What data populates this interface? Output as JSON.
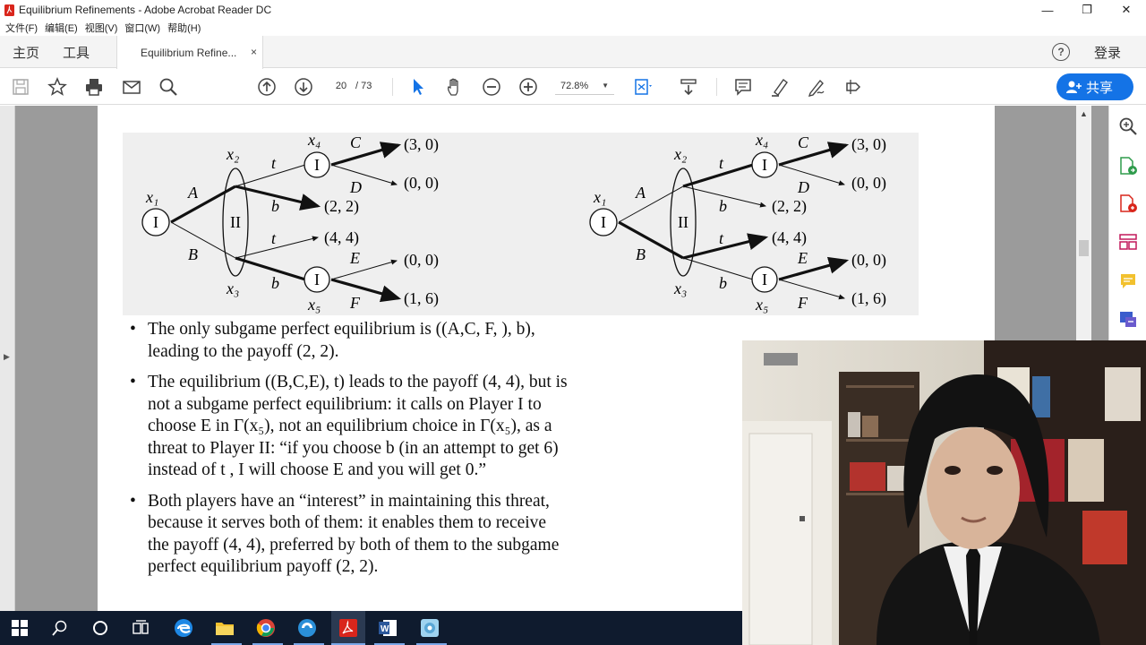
{
  "window": {
    "title": "Equilibrium Refinements - Adobe Acrobat Reader DC",
    "controls": [
      "—",
      "❐",
      "✕"
    ]
  },
  "menu": [
    "文件(F)",
    "编辑(E)",
    "视图(V)",
    "窗口(W)",
    "帮助(H)"
  ],
  "tabs": {
    "home": "主页",
    "tools": "工具",
    "document": "Equilibrium Refine...",
    "close": "×",
    "help": "?",
    "login": "登录"
  },
  "toolbar": {
    "page_current": "20",
    "page_total": "/ 73",
    "zoom": "72.8%",
    "share_label": "共享",
    "icons": [
      "save-icon",
      "star-icon",
      "print-icon",
      "mail-icon",
      "search-icon",
      "page-up-icon",
      "page-down-icon",
      "select-arrow-icon",
      "hand-icon",
      "zoom-out-icon",
      "zoom-in-icon",
      "fit-page-icon",
      "scroll-mode-icon",
      "comment-icon",
      "highlight-icon",
      "sign-icon",
      "fill-sign-icon"
    ]
  },
  "figure": {
    "left_tree": {
      "nodes": {
        "x1": "x₁",
        "x2": "x₂",
        "x3": "x₃",
        "x4": "x₄",
        "x5": "x₅"
      },
      "player_I": "I",
      "player_II": "II",
      "actions": [
        "A",
        "B",
        "t",
        "b",
        "t",
        "b",
        "C",
        "D",
        "E",
        "F"
      ],
      "payoffs": [
        "(3, 0)",
        "(0, 0)",
        "(2, 2)",
        "(4, 4)",
        "(0, 0)",
        "(1, 6)"
      ]
    },
    "right_tree": {
      "nodes": {
        "x1": "x₁",
        "x2": "x₂",
        "x3": "x₃",
        "x4": "x₄",
        "x5": "x₅"
      },
      "player_I": "I",
      "player_II": "II",
      "actions": [
        "A",
        "B",
        "t",
        "b",
        "t",
        "b",
        "C",
        "D",
        "E",
        "F"
      ],
      "payoffs": [
        "(3, 0)",
        "(0, 0)",
        "(2, 2)",
        "(4, 4)",
        "(0, 0)",
        "(1, 6)"
      ]
    }
  },
  "bullets": [
    {
      "lines": [
        "The only subgame perfect equilibrium is ((A,C, F, ), b),",
        "leading to the payoff (2, 2)."
      ]
    },
    {
      "lines": [
        "The equilibrium ((B,C,E), t) leads to the payoff (4, 4), but is",
        "not a subgame perfect equilibrium: it calls on Player I to",
        "choose E in Γ(x₅), not an equilibrium choice in Γ(x₅), as a",
        "threat to Player II: “if you choose b (in an attempt to get 6)",
        "instead of t , I will choose E and you will get 0.”"
      ]
    },
    {
      "lines": [
        "Both players have an “interest” in maintaining this threat,",
        "because it serves both of them: it enables them to receive",
        "the payoff (4, 4), preferred by both of them to the subgame",
        "perfect equilibrium payoff (2, 2)."
      ]
    }
  ],
  "right_panel_icons": [
    "zoom-icon",
    "export-pdf-icon",
    "create-pdf-icon",
    "organize-pages-icon",
    "comment-tool-icon",
    "more-tools-icon"
  ],
  "taskbar": [
    "windows-start-icon",
    "search-icon",
    "cortana-icon",
    "task-view-icon",
    "edge-icon",
    "file-explorer-icon",
    "chrome-icon",
    "browser-icon",
    "acrobat-icon",
    "word-icon",
    "app-icon"
  ],
  "colors": {
    "share_blue": "#1473e6",
    "taskbar": "#0f1b2e",
    "acrobat_red": "#d9261c"
  }
}
